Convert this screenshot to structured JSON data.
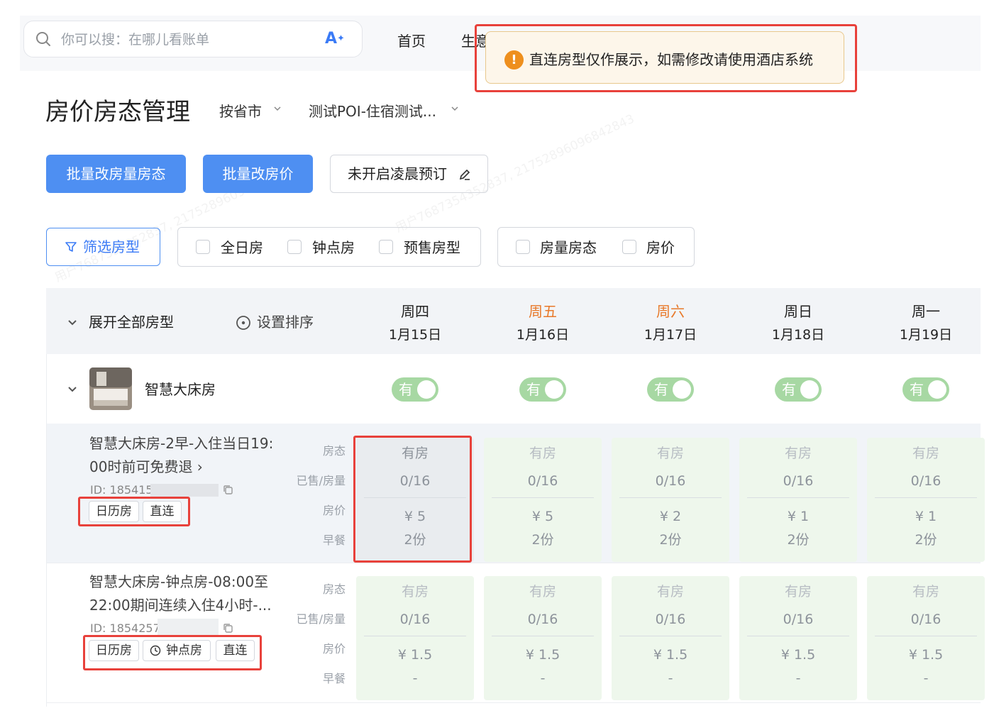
{
  "search": {
    "placeholder": "你可以搜：在哪儿看账单",
    "ai_label": "A"
  },
  "nav": {
    "items": [
      "首页",
      "生意"
    ]
  },
  "toast": {
    "icon": "!",
    "text": "直连房型仅作展示，如需修改请使用酒店系统"
  },
  "page": {
    "title": "房价房态管理",
    "region_selector": "按省市",
    "poi_selector": "测试POI-住宿测试..."
  },
  "actions": {
    "batch_status": "批量改房量房态",
    "batch_price": "批量改房价",
    "early_booking": "未开启凌晨预订"
  },
  "filters": {
    "filter_button": "筛选房型",
    "room_types": [
      "全日房",
      "钟点房",
      "预售房型"
    ],
    "display": [
      "房量房态",
      "房价"
    ]
  },
  "table": {
    "expand_all": "展开全部房型",
    "sort_setting": "设置排序",
    "days": [
      {
        "weekday": "周四",
        "date": "1月15日",
        "weekend": false
      },
      {
        "weekday": "周五",
        "date": "1月16日",
        "weekend": true
      },
      {
        "weekday": "周六",
        "date": "1月17日",
        "weekend": true
      },
      {
        "weekday": "周日",
        "date": "1月18日",
        "weekend": false
      },
      {
        "weekday": "周一",
        "date": "1月19日",
        "weekend": false
      }
    ],
    "weekend_color": "#e8792a",
    "row_labels": [
      "房态",
      "已售/房量",
      "房价",
      "早餐"
    ],
    "room": {
      "name": "智慧大床房",
      "toggle_label": "有",
      "toggle_color": "#a7d8a3"
    },
    "plans": [
      {
        "name_line1": "智慧大床房-2早-入住当日19:",
        "name_line2": "00时前可免费退 ›",
        "id": "ID: 185415",
        "tags": [
          "日历房",
          "直连"
        ],
        "cells": [
          {
            "status": "有房",
            "sold": "0/16",
            "price": "¥ 5",
            "breakfast": "2份"
          },
          {
            "status": "有房",
            "sold": "0/16",
            "price": "¥ 5",
            "breakfast": "2份"
          },
          {
            "status": "有房",
            "sold": "0/16",
            "price": "¥ 2",
            "breakfast": "2份"
          },
          {
            "status": "有房",
            "sold": "0/16",
            "price": "¥ 1",
            "breakfast": "2份"
          },
          {
            "status": "有房",
            "sold": "0/16",
            "price": "¥ 1",
            "breakfast": "2份"
          }
        ]
      },
      {
        "name_line1": "智慧大床房-钟点房-08:00至",
        "name_line2": "22:00期间连续入住4小时-...",
        "id": "ID: 1854257",
        "tags": [
          "日历房",
          "钟点房",
          "直连"
        ],
        "cells": [
          {
            "status": "有房",
            "sold": "0/16",
            "price": "¥ 1.5",
            "breakfast": "-"
          },
          {
            "status": "有房",
            "sold": "0/16",
            "price": "¥ 1.5",
            "breakfast": "-"
          },
          {
            "status": "有房",
            "sold": "0/16",
            "price": "¥ 1.5",
            "breakfast": "-"
          },
          {
            "status": "有房",
            "sold": "0/16",
            "price": "¥ 1.5",
            "breakfast": "-"
          },
          {
            "status": "有房",
            "sold": "0/16",
            "price": "¥ 1.5",
            "breakfast": "-"
          }
        ]
      }
    ]
  },
  "watermark": "用户7687354352837, 21752896096842843",
  "colors": {
    "primary": "#4e8ff2",
    "highlight": "#e8413b",
    "available_green": "#eef7ec"
  }
}
